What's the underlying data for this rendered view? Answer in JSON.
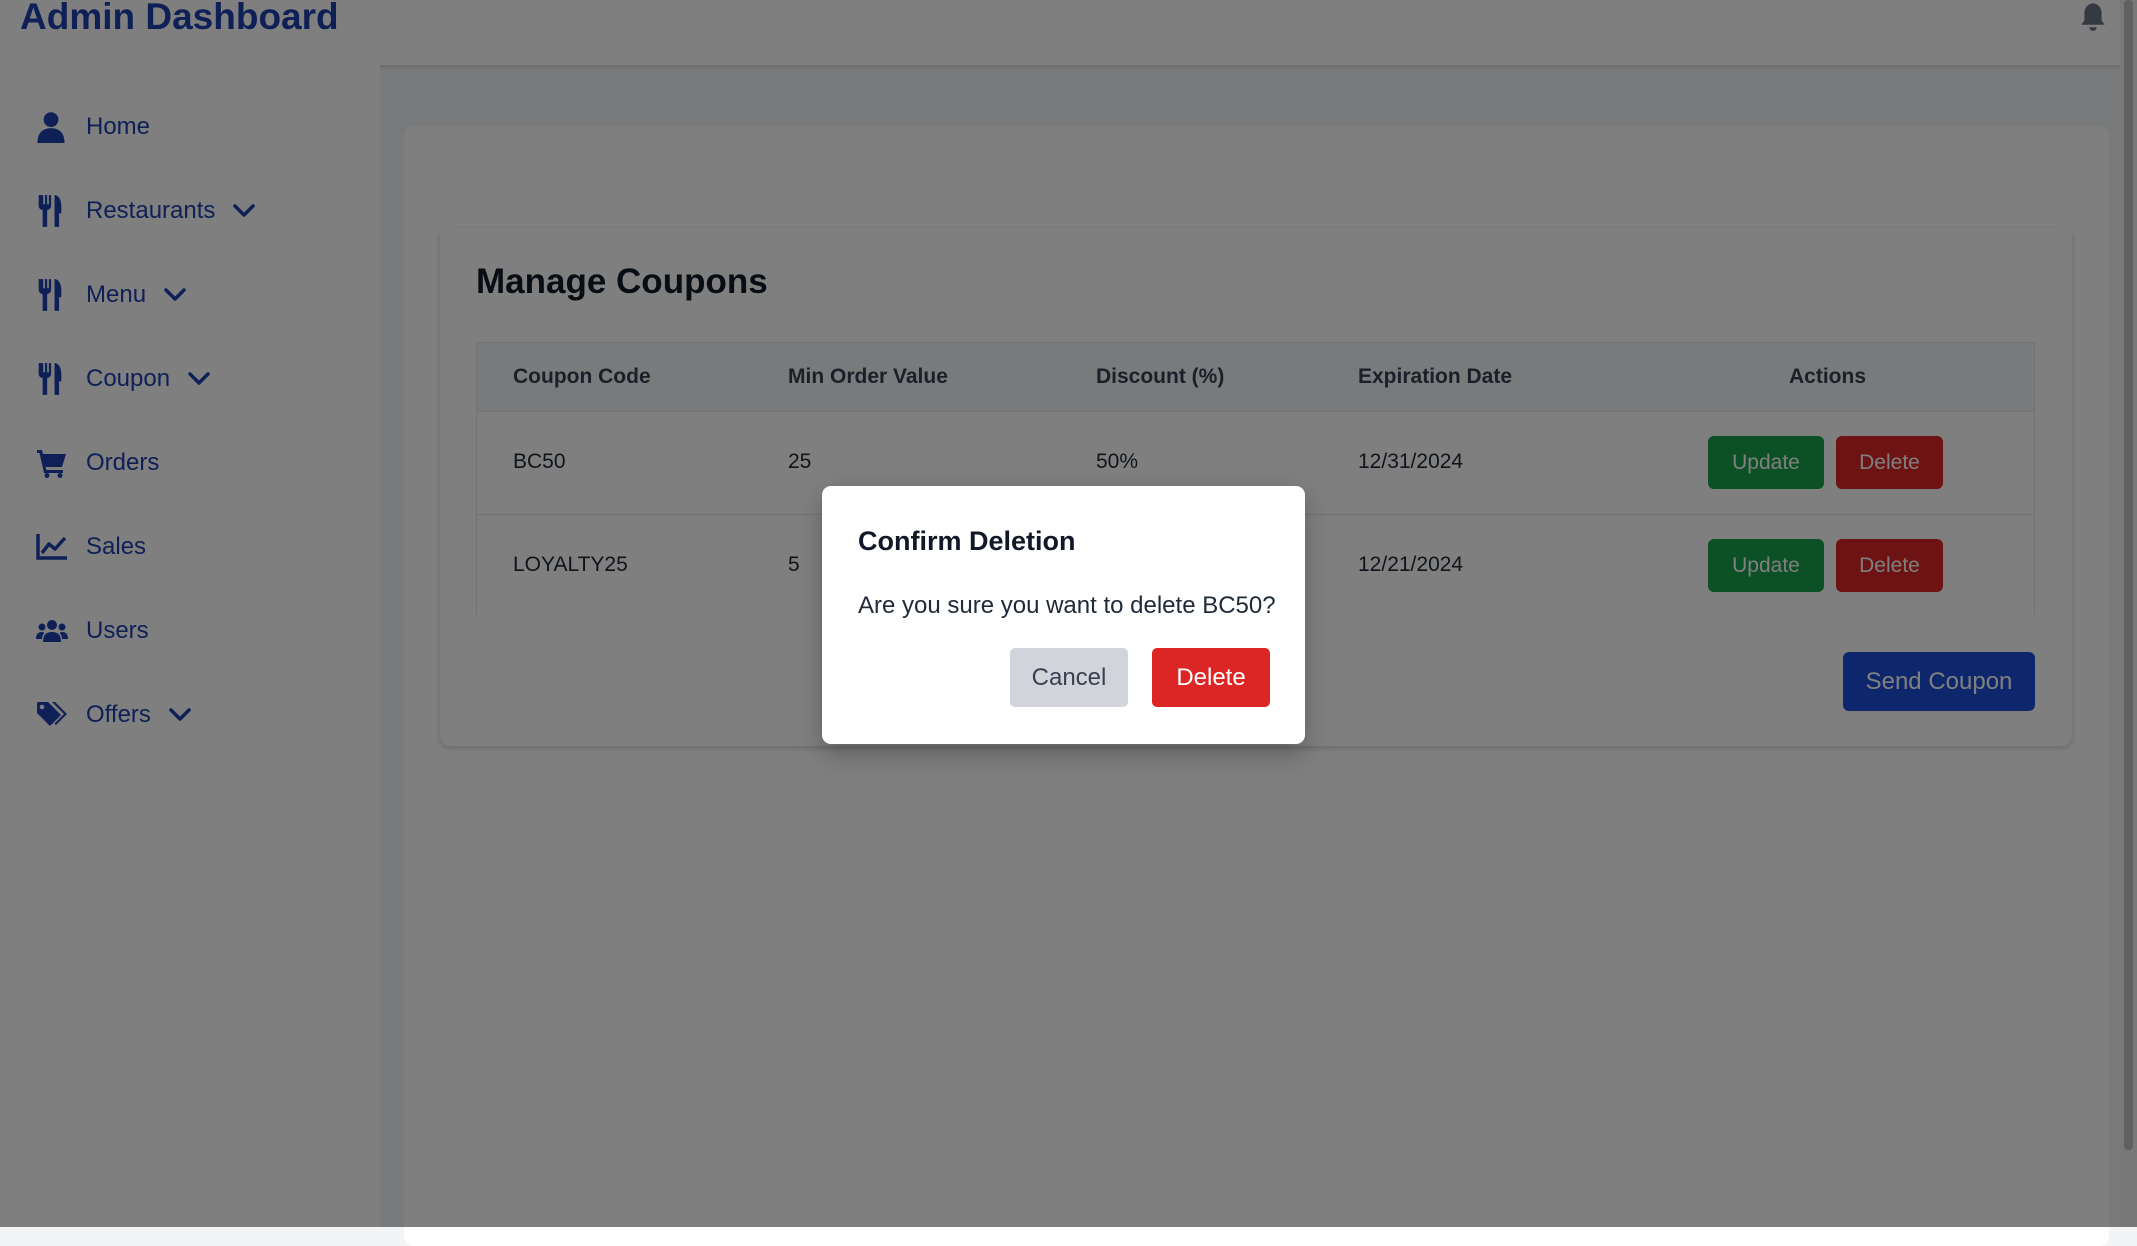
{
  "header": {
    "title": "Admin Dashboard",
    "bell_icon": "bell-icon"
  },
  "sidebar": {
    "items": [
      {
        "label": "Home",
        "icon": "user-icon",
        "has_dropdown": false
      },
      {
        "label": "Restaurants",
        "icon": "utensils-icon",
        "has_dropdown": true
      },
      {
        "label": "Menu",
        "icon": "utensils-icon",
        "has_dropdown": true
      },
      {
        "label": "Coupon",
        "icon": "utensils-icon",
        "has_dropdown": true
      },
      {
        "label": "Orders",
        "icon": "cart-icon",
        "has_dropdown": false
      },
      {
        "label": "Sales",
        "icon": "chart-line-icon",
        "has_dropdown": false
      },
      {
        "label": "Users",
        "icon": "users-icon",
        "has_dropdown": false
      },
      {
        "label": "Offers",
        "icon": "tags-icon",
        "has_dropdown": true
      }
    ]
  },
  "main": {
    "title": "Manage Coupons",
    "table": {
      "headers": [
        "Coupon Code",
        "Min Order Value",
        "Discount (%)",
        "Expiration Date",
        "Actions"
      ],
      "rows": [
        {
          "code": "BC50",
          "min_order": "25",
          "discount": "50%",
          "expiration": "12/31/2024",
          "update_label": "Update",
          "delete_label": "Delete"
        },
        {
          "code": "LOYALTY25",
          "min_order": "5",
          "discount": "",
          "expiration": "12/21/2024",
          "update_label": "Update",
          "delete_label": "Delete"
        }
      ]
    },
    "send_coupon_label": "Send Coupon"
  },
  "modal": {
    "title": "Confirm Deletion",
    "message": "Are you sure you want to delete BC50?",
    "cancel_label": "Cancel",
    "delete_label": "Delete"
  },
  "colors": {
    "brand": "#1e40af",
    "update": "#16a34a",
    "delete": "#dc2626",
    "send": "#1d4ed8",
    "cancel": "#d1d5db"
  }
}
